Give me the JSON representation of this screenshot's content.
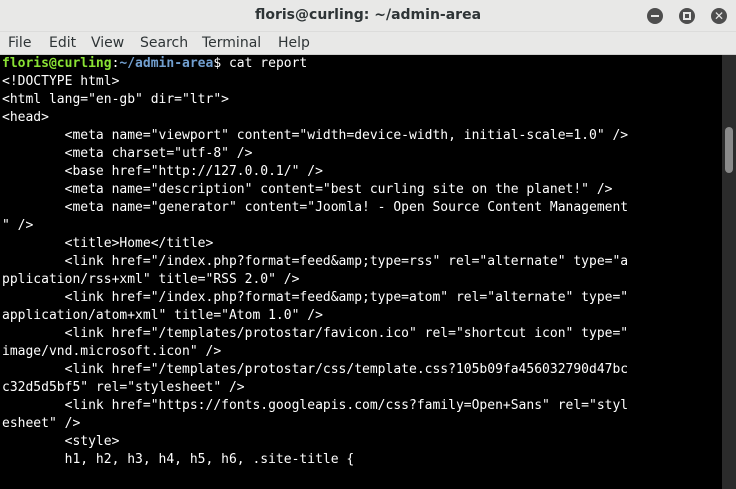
{
  "window": {
    "title": "floris@curling: ~/admin-area"
  },
  "controls": {
    "minimize_icon": "minimize-icon",
    "maximize_icon": "maximize-icon",
    "close_icon": "close-icon",
    "close_glyph": "✕"
  },
  "menubar": {
    "items": [
      "File",
      "Edit",
      "View",
      "Search",
      "Terminal",
      "Help"
    ]
  },
  "prompt": {
    "user_host": "floris@curling",
    "separator": ":",
    "path": "~/admin-area",
    "symbol": "$ ",
    "command": "cat report"
  },
  "output": {
    "lines": [
      "<!DOCTYPE html>",
      "<html lang=\"en-gb\" dir=\"ltr\">",
      "<head>",
      "        <meta name=\"viewport\" content=\"width=device-width, initial-scale=1.0\" />",
      "        <meta charset=\"utf-8\" />",
      "        <base href=\"http://127.0.0.1/\" />",
      "        <meta name=\"description\" content=\"best curling site on the planet!\" />",
      "        <meta name=\"generator\" content=\"Joomla! - Open Source Content Management",
      "\" />",
      "        <title>Home</title>",
      "        <link href=\"/index.php?format=feed&amp;type=rss\" rel=\"alternate\" type=\"a",
      "pplication/rss+xml\" title=\"RSS 2.0\" />",
      "        <link href=\"/index.php?format=feed&amp;type=atom\" rel=\"alternate\" type=\"",
      "application/atom+xml\" title=\"Atom 1.0\" />",
      "        <link href=\"/templates/protostar/favicon.ico\" rel=\"shortcut icon\" type=\"",
      "image/vnd.microsoft.icon\" />",
      "        <link href=\"/templates/protostar/css/template.css?105b09fa456032790d47bc",
      "c32d5d5bf5\" rel=\"stylesheet\" />",
      "        <link href=\"https://fonts.googleapis.com/css?family=Open+Sans\" rel=\"styl",
      "esheet\" />",
      "        <style>",
      "",
      "        h1, h2, h3, h4, h5, h6, .site-title {"
    ]
  },
  "colors": {
    "user_host": "#8ae234",
    "path": "#729fcf",
    "text": "#ffffff",
    "background": "#000000"
  }
}
